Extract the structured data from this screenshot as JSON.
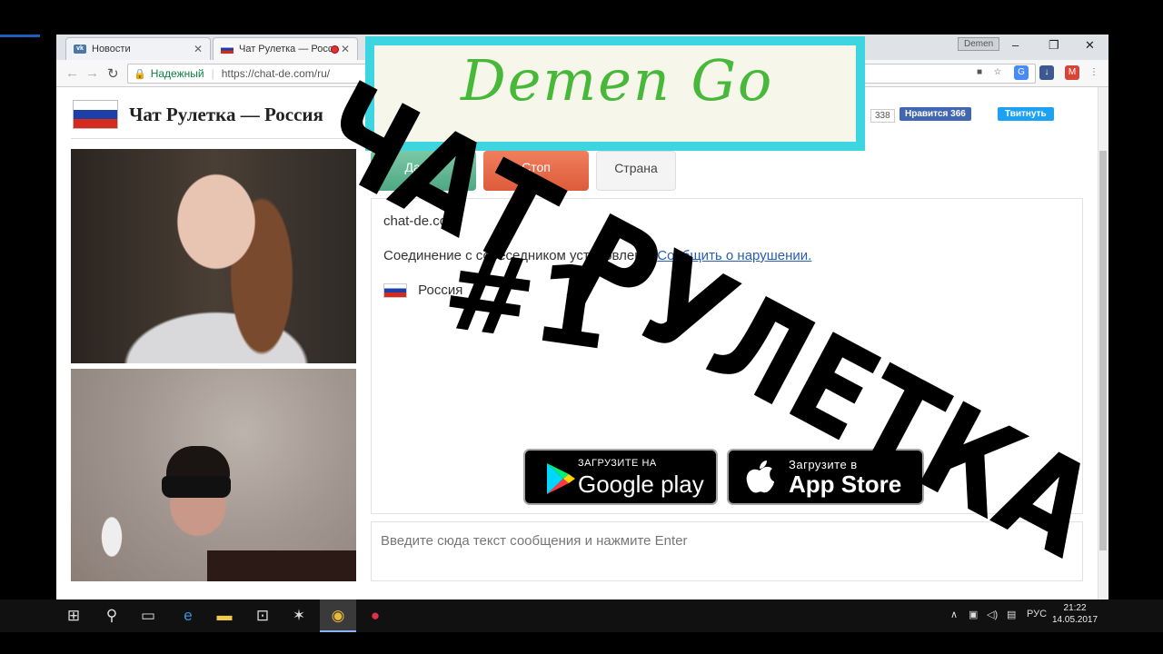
{
  "browser": {
    "tabs": [
      {
        "title": "Новости",
        "favicon": "vk-icon"
      },
      {
        "title": "Чат Рулетка — Росси",
        "favicon": "russia-flag-icon",
        "recording": true
      }
    ],
    "user_badge": "Demen",
    "window_controls": {
      "minimize": "–",
      "restore": "❐",
      "close": "✕"
    },
    "security_label": "Надежный",
    "url": "https://chat-de.com/ru/"
  },
  "page": {
    "site_title": "Чат Рулетка — Россия",
    "like_count": "338",
    "fb_like_label": "Нравится 366",
    "tweet_label": "Твитнуть",
    "buttons": {
      "next": "Далее",
      "stop": "Стоп",
      "country": "Страна"
    },
    "chat": {
      "site_name": "chat-de.com",
      "connection_text": "Соединение с собеседником установлено.",
      "report_link": "Сообщить о нарушении.",
      "partner_country": "Россия"
    },
    "store": {
      "google_small": "ЗАГРУЗИТЕ НА",
      "google_big": "Google play",
      "apple_small": "Загрузите в",
      "apple_big": "App Store"
    },
    "message_placeholder": "Введите сюда текст сообщения и нажмите Enter"
  },
  "overlay": {
    "logo_text": "Demen Go",
    "handwritten_title": "ЧАТ РУЛЕТКА",
    "handwritten_number": "#1"
  },
  "taskbar": {
    "tray_language": "РУС",
    "clock_time": "21:22",
    "clock_date": "14.05.2017"
  },
  "colors": {
    "next_button": "#5bb592",
    "stop_button": "#e8694a",
    "logo_border": "#3dd6e0",
    "logo_text": "#47b83a",
    "facebook": "#4267b2",
    "twitter": "#1da1f2"
  }
}
